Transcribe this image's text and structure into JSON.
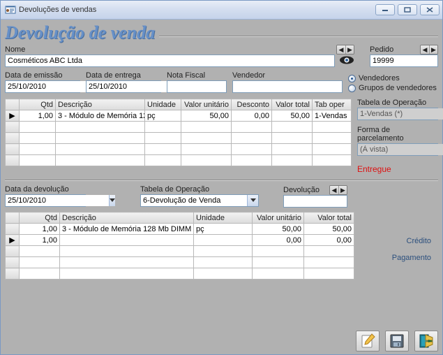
{
  "window": {
    "title": "Devoluções de vendas"
  },
  "bigtitle": "Devolução de venda",
  "labels": {
    "nome": "Nome",
    "pedido": "Pedido",
    "dataEmissao": "Data de emissão",
    "dataEntrega": "Data de entrega",
    "notaFiscal": "Nota Fiscal",
    "vendedor": "Vendedor",
    "tabOperacao": "Tabela de Operação",
    "formaParcel": "Forma de parcelamento",
    "dataDevolucao": "Data da devolução",
    "devolucao": "Devolução",
    "radioVend": "Vendedores",
    "radioGrupo": "Grupos de vendedores"
  },
  "values": {
    "nome": "Cosméticos ABC Ltda",
    "pedido": "19999",
    "dataEmissao": "25/10/2010",
    "dataEntrega": "25/10/2010",
    "notaFiscal": "",
    "vendedor": "",
    "tabOperacaoSide": "1-Vendas (*)",
    "formaParcel": "(À vista)",
    "status": "Entregue",
    "dataDevolucao": "25/10/2010",
    "tabOperacaoDev": "6-Devolução de Venda",
    "devolucao": ""
  },
  "grid1": {
    "headers": [
      "Qtd",
      "Descrição",
      "Unidade",
      "Valor unitário",
      "Desconto",
      "Valor total",
      "Tab oper"
    ],
    "rows": [
      {
        "qtd": "1,00",
        "descricao": "3 - Módulo de Memória 12",
        "unidade": "pç",
        "valunit": "50,00",
        "desconto": "0,00",
        "valtotal": "50,00",
        "taboper": "1-Vendas"
      }
    ],
    "blankRows": 4
  },
  "grid2": {
    "headers": [
      "Qtd",
      "Descrição",
      "Unidade",
      "Valor unitário",
      "Valor total"
    ],
    "rows": [
      {
        "qtd": "1,00",
        "descricao": "3 - Módulo de Memória 128 Mb DIMM",
        "unidade": "pç",
        "valunit": "50,00",
        "valtotal": "50,00"
      },
      {
        "qtd": "1,00",
        "descricao": "",
        "unidade": "",
        "valunit": "0,00",
        "valtotal": "0,00"
      }
    ],
    "blankRows": 3
  },
  "sidebar": {
    "credito": "Crédito",
    "pagamento": "Pagamento"
  }
}
